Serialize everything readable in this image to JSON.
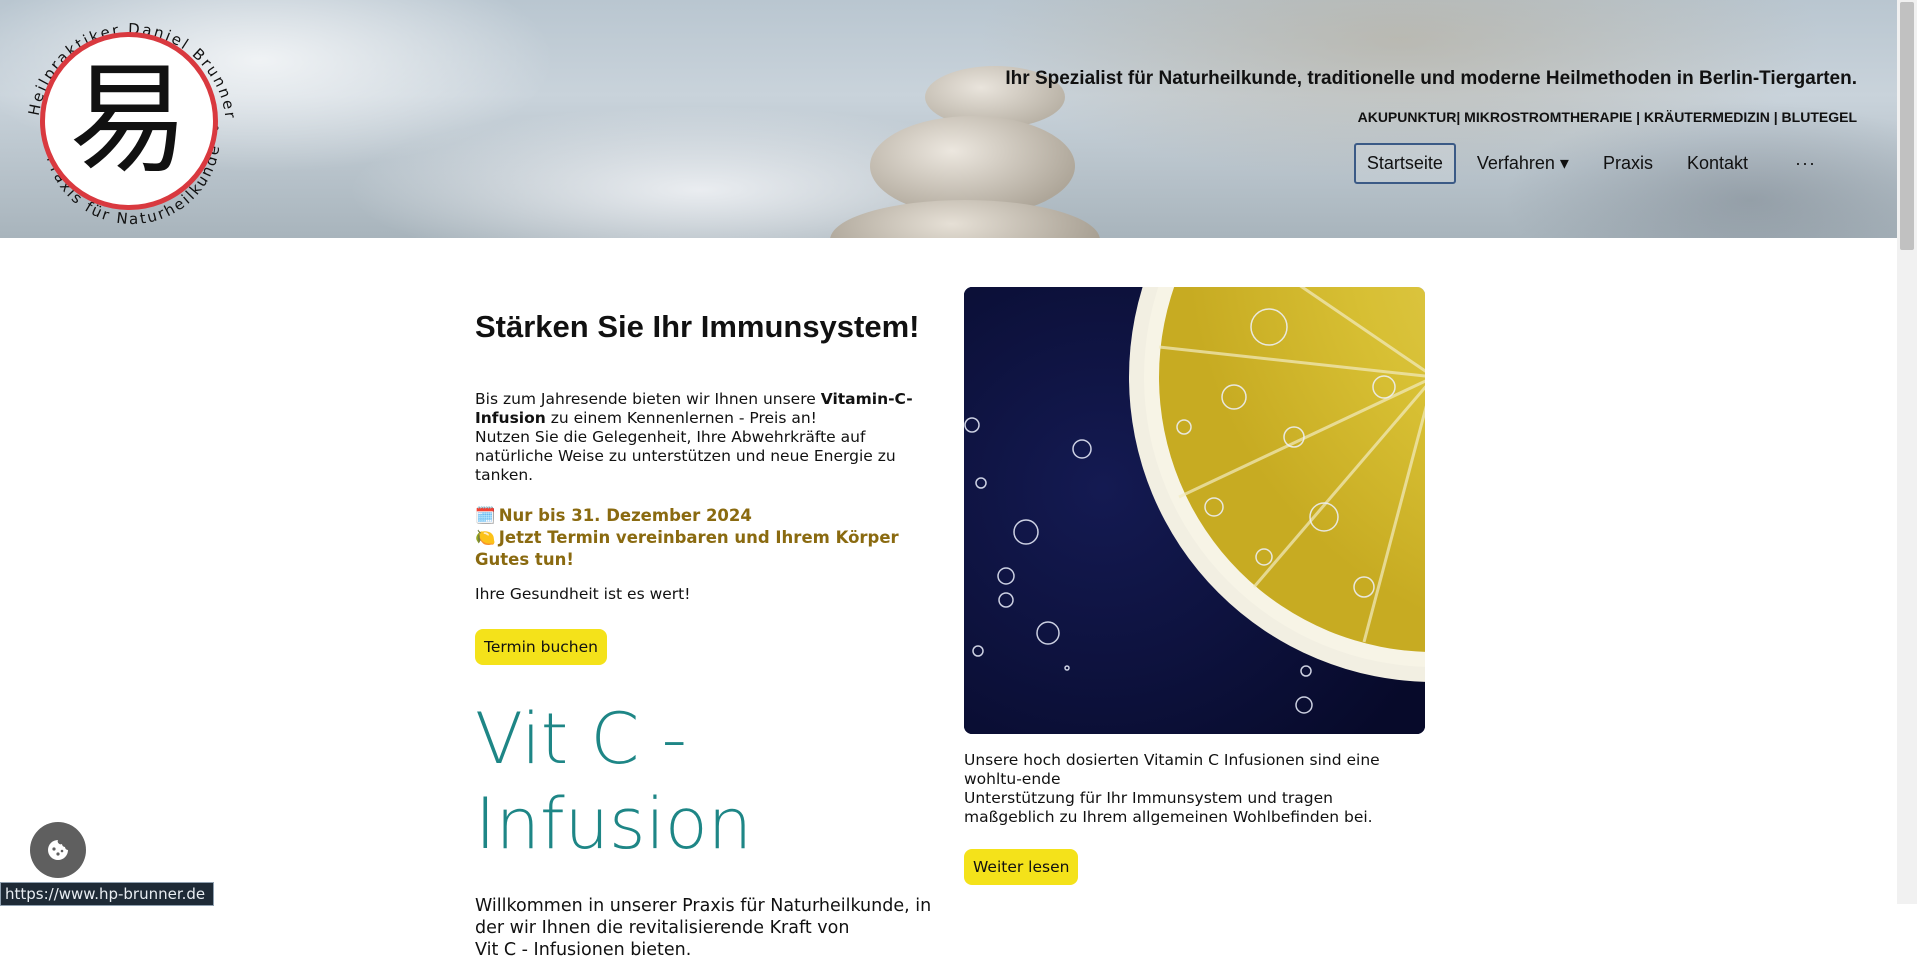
{
  "header": {
    "logo": {
      "ring_text_top": "Heilpraktiker Daniel Brunner",
      "ring_text_bottom": "Praxis für Naturheilkunde",
      "glyph": "易"
    },
    "tagline": "Ihr Spezialist für Naturheilkunde, traditionelle und moderne Heilmethoden in Berlin-Tiergarten.",
    "services": "AKUPUNKTUR| MIKROSTROMTHERAPIE | KRÄUTERMEDIZIN | BLUTEGEL",
    "nav": {
      "items": [
        {
          "label": "Startseite",
          "active": true
        },
        {
          "label": "Verfahren ▾",
          "active": false
        },
        {
          "label": "Praxis",
          "active": false
        },
        {
          "label": "Kontakt",
          "active": false
        }
      ],
      "more": "···"
    }
  },
  "main": {
    "heading": "Stärken Sie Ihr Immunsystem!",
    "intro_before": "Bis zum Jahresende bieten wir Ihnen unsere ",
    "intro_bold": "Vitamin-C-Infusion",
    "intro_after": " zu einem Kennenlernen - Preis an!",
    "intro_line2": "Nutzen Sie die Gelegenheit, Ihre Abwehrkräfte auf natürliche Weise zu unterstützen und neue Energie zu tanken.",
    "promo_1_icon": "🗓️",
    "promo_1": "Nur bis 31. Dezember 2024",
    "promo_2_icon": "🍋",
    "promo_2": "Jetzt Termin vereinbaren und Ihrem Körper Gutes tun!",
    "health": "Ihre Gesundheit ist es wert!",
    "book_button": "Termin buchen",
    "vitc_line1": "Vit C -",
    "vitc_line2": "Infusion",
    "welcome": "Willkommen in unserer Praxis für Naturheilkunde, in der wir Ihnen die revitalisierende Kraft von",
    "welcome_line3": "Vit C - Infusionen bieten."
  },
  "aside": {
    "image_alt": "lemon-slice-in-sparkling-water",
    "text_line1": "Unsere hoch dosierten Vitamin C Infusionen sind eine wohltu-ende",
    "text_line2": "Unterstützung für Ihr Immunsystem und tragen maßgeblich zu Ihrem allgemeinen Wohlbefinden bei.",
    "more_button": "Weiter lesen"
  },
  "status_url": "https://www.hp-brunner.de",
  "colors": {
    "accent_yellow": "#f4e21a",
    "teal": "#1e8686",
    "promo": "#8a6a10",
    "logo_red": "#d9393f"
  },
  "icons": {
    "cookie": "cookie-icon"
  }
}
